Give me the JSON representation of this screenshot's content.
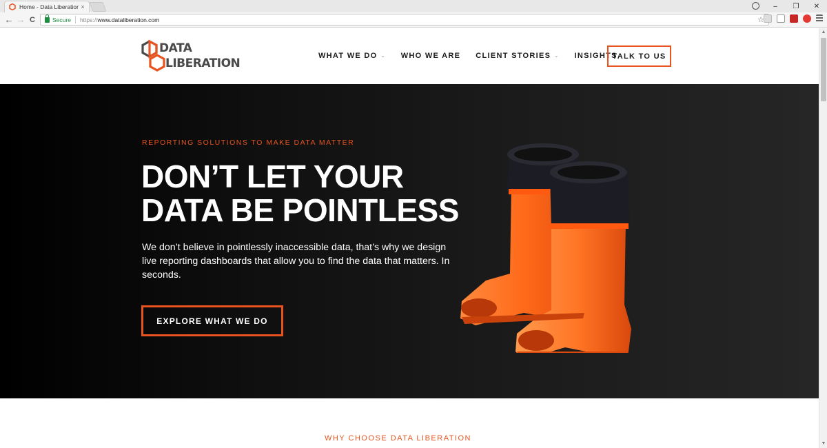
{
  "browser": {
    "tab_title": "Home - Data Liberation",
    "tab_close": "×",
    "window_minimize": "–",
    "window_restore": "❐",
    "window_close": "✕",
    "secure_label": "Secure",
    "url_scheme": "https://",
    "url_host": "www.dataliberation.com",
    "back": "←",
    "forward": "→",
    "reload": "C",
    "bookmark_star": "☆"
  },
  "header": {
    "logo_line1": "DATA",
    "logo_line2": "LIBERATION",
    "nav": [
      {
        "label": "WHAT WE DO",
        "has_dropdown": true
      },
      {
        "label": "WHO WE ARE",
        "has_dropdown": false
      },
      {
        "label": "CLIENT STORIES",
        "has_dropdown": true
      },
      {
        "label": "INSIGHTS",
        "has_dropdown": false
      }
    ],
    "dropdown_glyph": "⌄",
    "cta_label": "TALK TO US"
  },
  "hero": {
    "eyebrow": "REPORTING SOLUTIONS TO MAKE DATA MATTER",
    "headline": "DON’T LET YOUR DATA BE POINTLESS",
    "subhead": "We don’t believe in pointlessly inaccessible data, that’s why we design live reporting dashboards that allow you to find the data that matters. In seconds.",
    "button_label": "EXPLORE WHAT WE DO"
  },
  "why": {
    "title": "WHY CHOOSE DATA LIBERATION"
  },
  "colors": {
    "accent": "#e8531f",
    "hero_bg": "#111111",
    "text_dark": "#1a1a1a"
  }
}
